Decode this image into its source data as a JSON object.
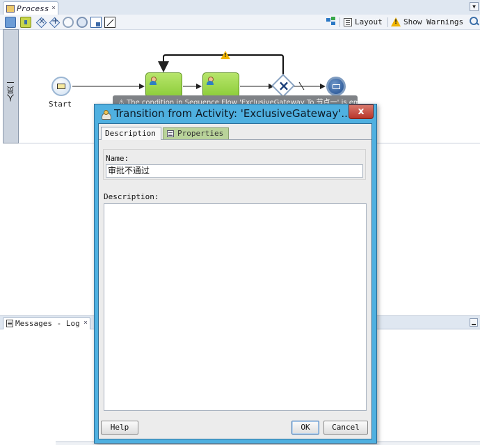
{
  "editor": {
    "tab_label": "Process",
    "tab_close": "×",
    "toolbar": {
      "layout_label": "Layout",
      "warnings_label": "Show Warnings"
    }
  },
  "diagram": {
    "lane_label": "人员一",
    "start_label": "Start",
    "tooltip_text": "⚠ The condition in Sequence Flow 'ExclusiveGateway To 节点一' is empty"
  },
  "log_panel": {
    "tab_label": "Messages - Log",
    "tab_close": "×"
  },
  "dialog": {
    "title": "Transition from Activity: 'ExclusiveGateway'...",
    "close_glyph": "x",
    "tabs": [
      "Description",
      "Properties"
    ],
    "name_label": "Name:",
    "name_value": "审批不通过",
    "description_label": "Description:",
    "description_value": "",
    "buttons": {
      "help": "Help",
      "ok": "OK",
      "cancel": "Cancel"
    }
  },
  "colors": {
    "dialog_frame": "#4fb0e0",
    "task_fill": "#9cd64a",
    "close_button": "#c9483c",
    "warning": "#f2b600"
  },
  "icons": {
    "lane_horizontal": "swimlane-horizontal-icon",
    "lane_vertical": "swimlane-vertical-icon",
    "exclusive_gateway": "exclusive-gateway-icon",
    "parallel_gateway": "parallel-gateway-icon",
    "start_event": "start-event-icon",
    "end_event": "end-event-icon",
    "zoom": "zoom-icon"
  }
}
